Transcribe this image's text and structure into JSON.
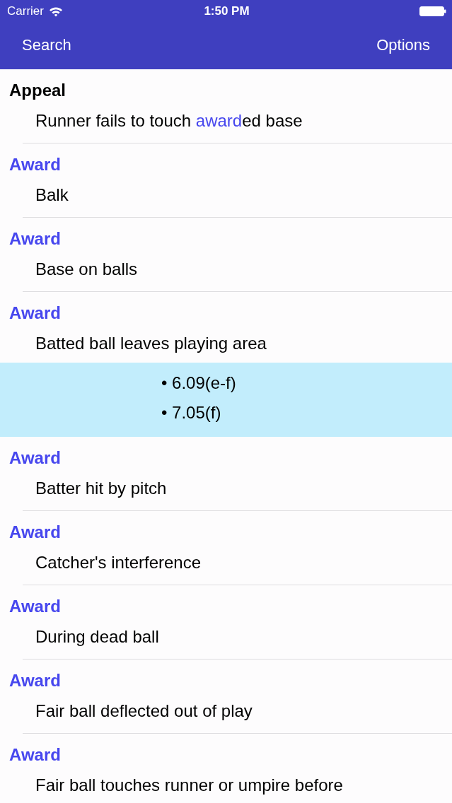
{
  "status_bar": {
    "carrier": "Carrier",
    "time": "1:50 PM"
  },
  "nav_bar": {
    "left_button": "Search",
    "right_button": "Options"
  },
  "results": [
    {
      "category": "Appeal",
      "matched": false,
      "description": [
        {
          "text": "Runner fails to touch ",
          "match": false
        },
        {
          "text": "award",
          "match": true
        },
        {
          "text": "ed base",
          "match": false
        }
      ]
    },
    {
      "category": "Award",
      "matched": true,
      "description": [
        {
          "text": "Balk",
          "match": false
        }
      ]
    },
    {
      "category": "Award",
      "matched": true,
      "description": [
        {
          "text": "Base on balls",
          "match": false
        }
      ]
    },
    {
      "category": "Award",
      "matched": true,
      "description": [
        {
          "text": "Batted ball leaves playing area",
          "match": false
        }
      ],
      "references": [
        "• 6.09(e-f)",
        "• 7.05(f)"
      ]
    },
    {
      "category": "Award",
      "matched": true,
      "description": [
        {
          "text": "Batter hit by pitch",
          "match": false
        }
      ]
    },
    {
      "category": "Award",
      "matched": true,
      "description": [
        {
          "text": "Catcher's interference",
          "match": false
        }
      ]
    },
    {
      "category": "Award",
      "matched": true,
      "description": [
        {
          "text": "During dead ball",
          "match": false
        }
      ]
    },
    {
      "category": "Award",
      "matched": true,
      "description": [
        {
          "text": "Fair ball deflected out of play",
          "match": false
        }
      ]
    },
    {
      "category": "Award",
      "matched": true,
      "description": [
        {
          "text": "Fair ball touches runner or umpire before",
          "match": false
        }
      ]
    }
  ]
}
